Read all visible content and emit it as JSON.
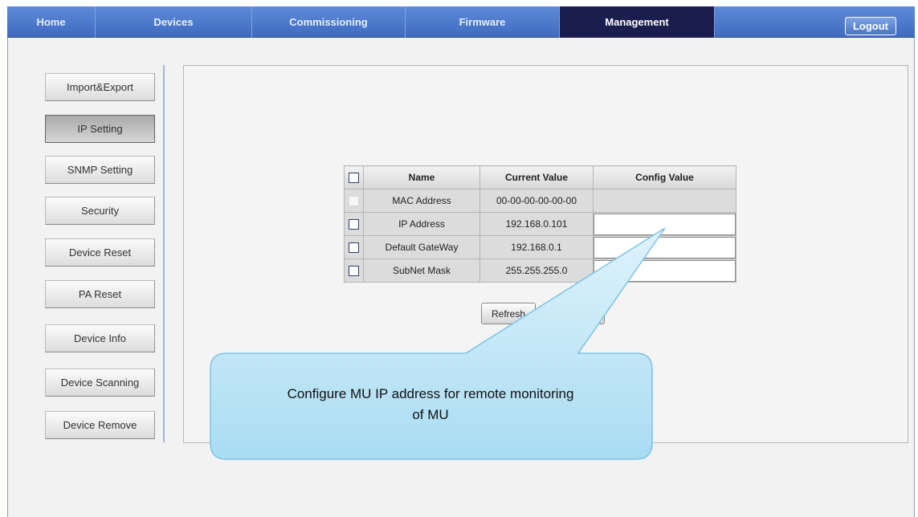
{
  "nav": {
    "tabs": [
      {
        "label": "Home"
      },
      {
        "label": "Devices"
      },
      {
        "label": "Commissioning"
      },
      {
        "label": "Firmware"
      },
      {
        "label": "Management"
      }
    ],
    "active_tab": "Management",
    "logout_label": "Logout"
  },
  "sidebar": {
    "items": [
      {
        "label": "Import&Export"
      },
      {
        "label": "IP Setting"
      },
      {
        "label": "SNMP Setting"
      },
      {
        "label": "Security"
      },
      {
        "label": "Device Reset"
      },
      {
        "label": "PA Reset"
      },
      {
        "label": "Device Info"
      },
      {
        "label": "Device Scanning"
      },
      {
        "label": "Device Remove"
      }
    ],
    "active_item": "IP Setting"
  },
  "table": {
    "headers": {
      "name": "Name",
      "current": "Current Value",
      "config": "Config Value"
    },
    "rows": [
      {
        "name": "MAC Address",
        "current": "00-00-00-00-00-00",
        "config": "",
        "editable": false
      },
      {
        "name": "IP Address",
        "current": "192.168.0.101",
        "config": "",
        "editable": true
      },
      {
        "name": "Default GateWay",
        "current": "192.168.0.1",
        "config": "",
        "editable": true
      },
      {
        "name": "SubNet Mask",
        "current": "255.255.255.0",
        "config": "",
        "editable": true
      }
    ]
  },
  "buttons": {
    "refresh_label": "Refresh"
  },
  "callout": {
    "line1": "Configure MU IP address for remote monitoring",
    "line2": "of MU"
  },
  "colors": {
    "nav_bg": "#4a78cc",
    "nav_active": "#1a1d4d",
    "callout_fill": "#bfe6f7",
    "callout_stroke": "#7cc3e6"
  }
}
